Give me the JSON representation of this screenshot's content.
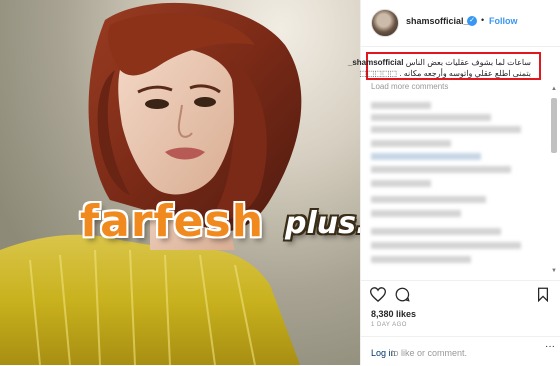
{
  "post": {
    "username": "shamsofficial_",
    "follow_label": "Follow",
    "separator": "•",
    "caption_line1": "ساعات لما بشوف عقليات بعض الناس",
    "caption_line2": "بتمنى اطلع عقلي واتوسه وأرجعه مكانه . ⬚⬚⬚⬚⬚",
    "load_more_label": "Load more comments",
    "likes": "8,380 likes",
    "time": "1 DAY AGO",
    "login_label": "Log in",
    "login_suffix": "to like or comment."
  },
  "watermark": {
    "main": "farfesh",
    "sub": "plus.com"
  },
  "colors": {
    "accent": "#3897f0",
    "highlight_border": "#e2161d",
    "watermark_orange": "#f08a1f"
  },
  "icons": [
    "verified-badge-icon",
    "heart-icon",
    "comment-icon",
    "bookmark-icon",
    "more-options-icon"
  ]
}
